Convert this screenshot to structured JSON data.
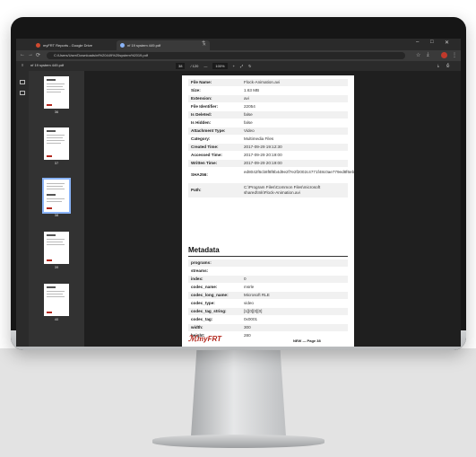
{
  "browser": {
    "tabs": [
      {
        "label": "myFRT Reports - Google Drive"
      },
      {
        "label": "nf 19 system 449.pdf"
      }
    ],
    "new_tab": "+",
    "win_controls": [
      "–",
      "□",
      "✕"
    ],
    "url": "C:/Users/User/Downloads/nf%20449%20system%2019.pdf",
    "nav_icons": [
      "←",
      "→",
      "⟳"
    ]
  },
  "pdf_toolbar": {
    "doc_name": "nf 19 system 449.pdf",
    "page_current": "38",
    "page_total": "/ 120",
    "zoom": "100%",
    "minus": "—",
    "plus": "+"
  },
  "thumbnails": [
    {
      "page": "36"
    },
    {
      "page": "37"
    },
    {
      "page": "38"
    },
    {
      "page": "39"
    },
    {
      "page": "40"
    }
  ],
  "page": {
    "rows": [
      {
        "label": "File Name:",
        "value": "Flock-Animation.avi"
      },
      {
        "label": "Size:",
        "value": "1.63 MB"
      },
      {
        "label": "Extension:",
        "value": "avi"
      },
      {
        "label": "File Identifier:",
        "value": "22054"
      },
      {
        "label": "Is Deleted:",
        "value": "false"
      },
      {
        "label": "Is Hidden:",
        "value": "false"
      },
      {
        "label": "Attachment Type:",
        "value": "Video"
      },
      {
        "label": "Category:",
        "value": "Multimedia Files"
      },
      {
        "label": "Created Time:",
        "value": "2017-09-29 19:12:30"
      },
      {
        "label": "Accessed Time:",
        "value": "2017-09-29 20:19:00"
      },
      {
        "label": "Written Time:",
        "value": "2017-09-29 20:19:00"
      },
      {
        "label": "SHA256:",
        "value": "ed8042f6cb8f8f8b4d9e2f7e2f2002c4771f48c0ae779ed8f6ebeb8a4f8e5"
      },
      {
        "label": "Path:",
        "value": "C:\\Program Files\\Common Files\\microsoft shared\\Ink\\Flock-Animation.avi"
      }
    ],
    "section_title": "Metadata",
    "meta_rows": [
      {
        "label": "programs:",
        "value": ""
      },
      {
        "label": "streams:",
        "value": ""
      },
      {
        "label": "index:",
        "value": "0"
      },
      {
        "label": "codec_name:",
        "value": "msrle"
      },
      {
        "label": "codec_long_name:",
        "value": "Microsoft RLE"
      },
      {
        "label": "codec_type:",
        "value": "video"
      },
      {
        "label": "codec_tag_string:",
        "value": "[1][0][0][0]"
      },
      {
        "label": "codec_tag:",
        "value": "0x0001"
      },
      {
        "label": "width:",
        "value": "300"
      },
      {
        "label": "height:",
        "value": "280"
      }
    ],
    "logo": "myFRT",
    "footer": "NEW — Page 38"
  }
}
